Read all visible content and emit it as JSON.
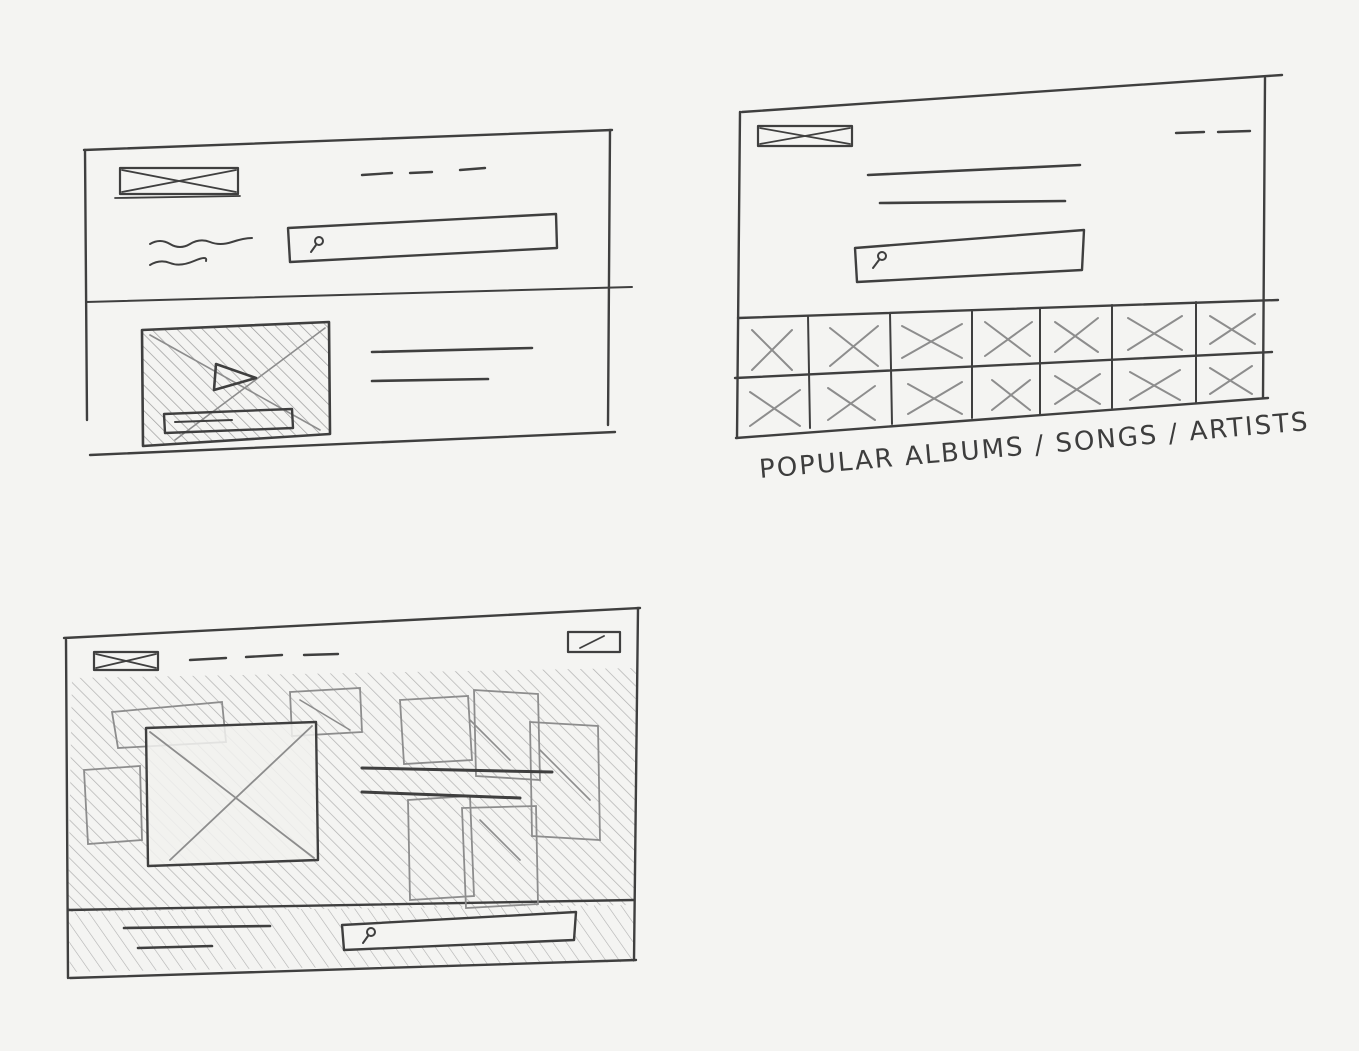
{
  "sketches": [
    {
      "id": "wireframe-search-detail",
      "elements": [
        "logo-placeholder",
        "nav-links",
        "scribble-tagline",
        "search-bar",
        "video-thumbnail",
        "play-icon",
        "thumbnail-button",
        "text-lines"
      ]
    },
    {
      "id": "wireframe-popular-grid",
      "elements": [
        "logo-placeholder",
        "nav-links",
        "headline-lines",
        "search-bar",
        "album-grid"
      ],
      "grid": {
        "rows": 2,
        "columns": 7
      },
      "caption": "POPULAR ALBUMS / SONGS / ARTISTS"
    },
    {
      "id": "wireframe-fullscreen-hero",
      "elements": [
        "logo-placeholder",
        "nav-links",
        "corner-button",
        "hatched-background",
        "hero-image",
        "text-lines",
        "footer-bar",
        "footer-search-bar"
      ]
    }
  ],
  "colors": {
    "paper": "#f4f4f2",
    "pencil": "#3f3f3f",
    "shading": "#8d8d8d"
  }
}
